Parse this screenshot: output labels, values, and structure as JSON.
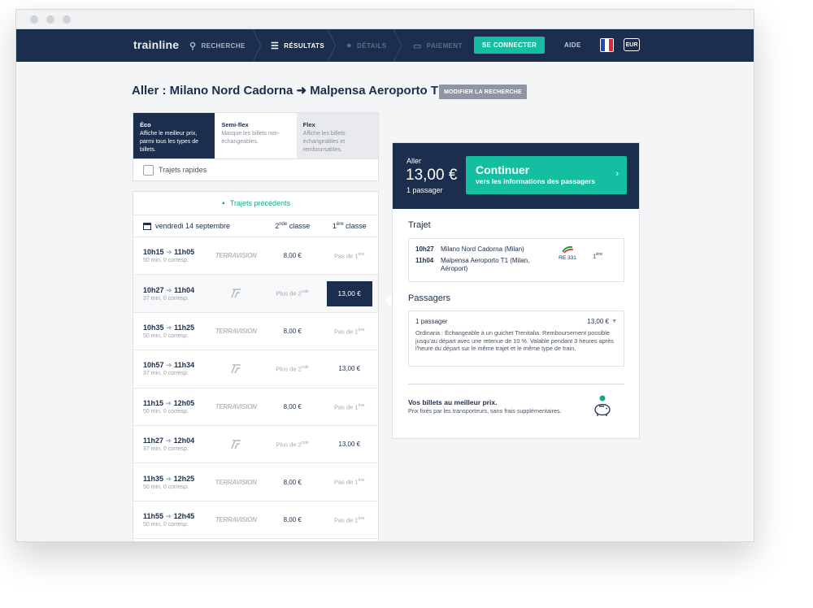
{
  "nav": {
    "logo": "trainline",
    "steps": [
      {
        "label": "RECHERCHE",
        "icon": "search-icon",
        "state": "done"
      },
      {
        "label": "RÉSULTATS",
        "icon": "list-icon",
        "state": "active"
      },
      {
        "label": "DÉTAILS",
        "icon": "user-icon",
        "state": "disabled"
      },
      {
        "label": "PAIEMENT",
        "icon": "card-icon",
        "state": "disabled"
      }
    ],
    "connect": "SE CONNECTER",
    "help": "AIDE",
    "currency": "EUR",
    "colors": {
      "navy": "#1b2e4e",
      "teal": "#13bfa0"
    }
  },
  "heading": {
    "title": "Aller : Milano Nord Cadorna ➜ Malpensa Aeroporto T1",
    "modify": "MODIFIER LA RECHERCHE"
  },
  "fares": [
    {
      "title": "Éco",
      "desc": "Affiche le meilleur prix, parmi tous les types de billets."
    },
    {
      "title": "Semi-flex",
      "desc": "Masque les billets non-échangeables."
    },
    {
      "title": "Flex",
      "desc": "Affiche les billets échangeables et remboursables."
    }
  ],
  "quick": {
    "label": "Trajets rapides"
  },
  "list": {
    "previous": "Trajets précédents",
    "date": "vendredi 14 septembre",
    "col2": {
      "num": "2",
      "sup": "nde",
      "word": " classe"
    },
    "col1": {
      "num": "1",
      "sup": "ère",
      "word": " classe"
    },
    "rows": [
      {
        "dep": "10h15",
        "arr": "11h05",
        "info": "50 min, 0 corresp.",
        "op": "Terravision",
        "p2": "8,00 €",
        "p1": "Pas de 1",
        "p1sup": "ère"
      },
      {
        "dep": "10h27",
        "arr": "11h04",
        "info": "37 min, 0 corresp.",
        "op": "Trenord",
        "p2": "Plus de 2",
        "p2sup": "nde",
        "p1": "13,00 €"
      },
      {
        "dep": "10h35",
        "arr": "11h25",
        "info": "50 min, 0 corresp.",
        "op": "Terravision",
        "p2": "8,00 €",
        "p1": "Pas de 1",
        "p1sup": "ère"
      },
      {
        "dep": "10h57",
        "arr": "11h34",
        "info": "37 min, 0 corresp.",
        "op": "Trenord",
        "p2": "Plus de 2",
        "p2sup": "nde",
        "p1": "13,00 €"
      },
      {
        "dep": "11h15",
        "arr": "12h05",
        "info": "50 min, 0 corresp.",
        "op": "Terravision",
        "p2": "8,00 €",
        "p1": "Pas de 1",
        "p1sup": "ère"
      },
      {
        "dep": "11h27",
        "arr": "12h04",
        "info": "37 min, 0 corresp.",
        "op": "Trenord",
        "p2": "Plus de 2",
        "p2sup": "nde",
        "p1": "13,00 €"
      },
      {
        "dep": "11h35",
        "arr": "12h25",
        "info": "50 min, 0 corresp.",
        "op": "Terravision",
        "p2": "8,00 €",
        "p1": "Pas de 1",
        "p1sup": "ère"
      },
      {
        "dep": "11h55",
        "arr": "12h45",
        "info": "50 min, 0 corresp.",
        "op": "Terravision",
        "p2": "8,00 €",
        "p1": "Pas de 1",
        "p1sup": "ère"
      }
    ]
  },
  "summary": {
    "aller": "Aller",
    "price": "13,00 €",
    "passengers": "1 passager",
    "continue_title": "Continuer",
    "continue_sub": "vers les informations des passagers",
    "trajet_title": "Trajet",
    "dep_time": "10h27",
    "dep_station": "Milano Nord Cadorna (Milan)",
    "arr_time": "11h04",
    "arr_station": "Malpensa Aeroporto T1 (Milan,",
    "arr_station2": "Aéroport)",
    "train": "RE 331",
    "class_num": "1",
    "class_sup": "ère",
    "pass_title": "Passagers",
    "pass_label": "1 passager",
    "pass_price": "13,00 €",
    "pass_desc": "Ordinaria : Échangeable à un guichet Trenitalia. Remboursement possible jusqu'au départ avec une retenue de 10 %. Valable pendant 3 heures après l'heure du départ sur le même trajet et le même type de train.",
    "best_title": "Vos billets au meilleur prix.",
    "best_sub": "Prix fixés par les transporteurs, sans frais supplémentaires."
  }
}
